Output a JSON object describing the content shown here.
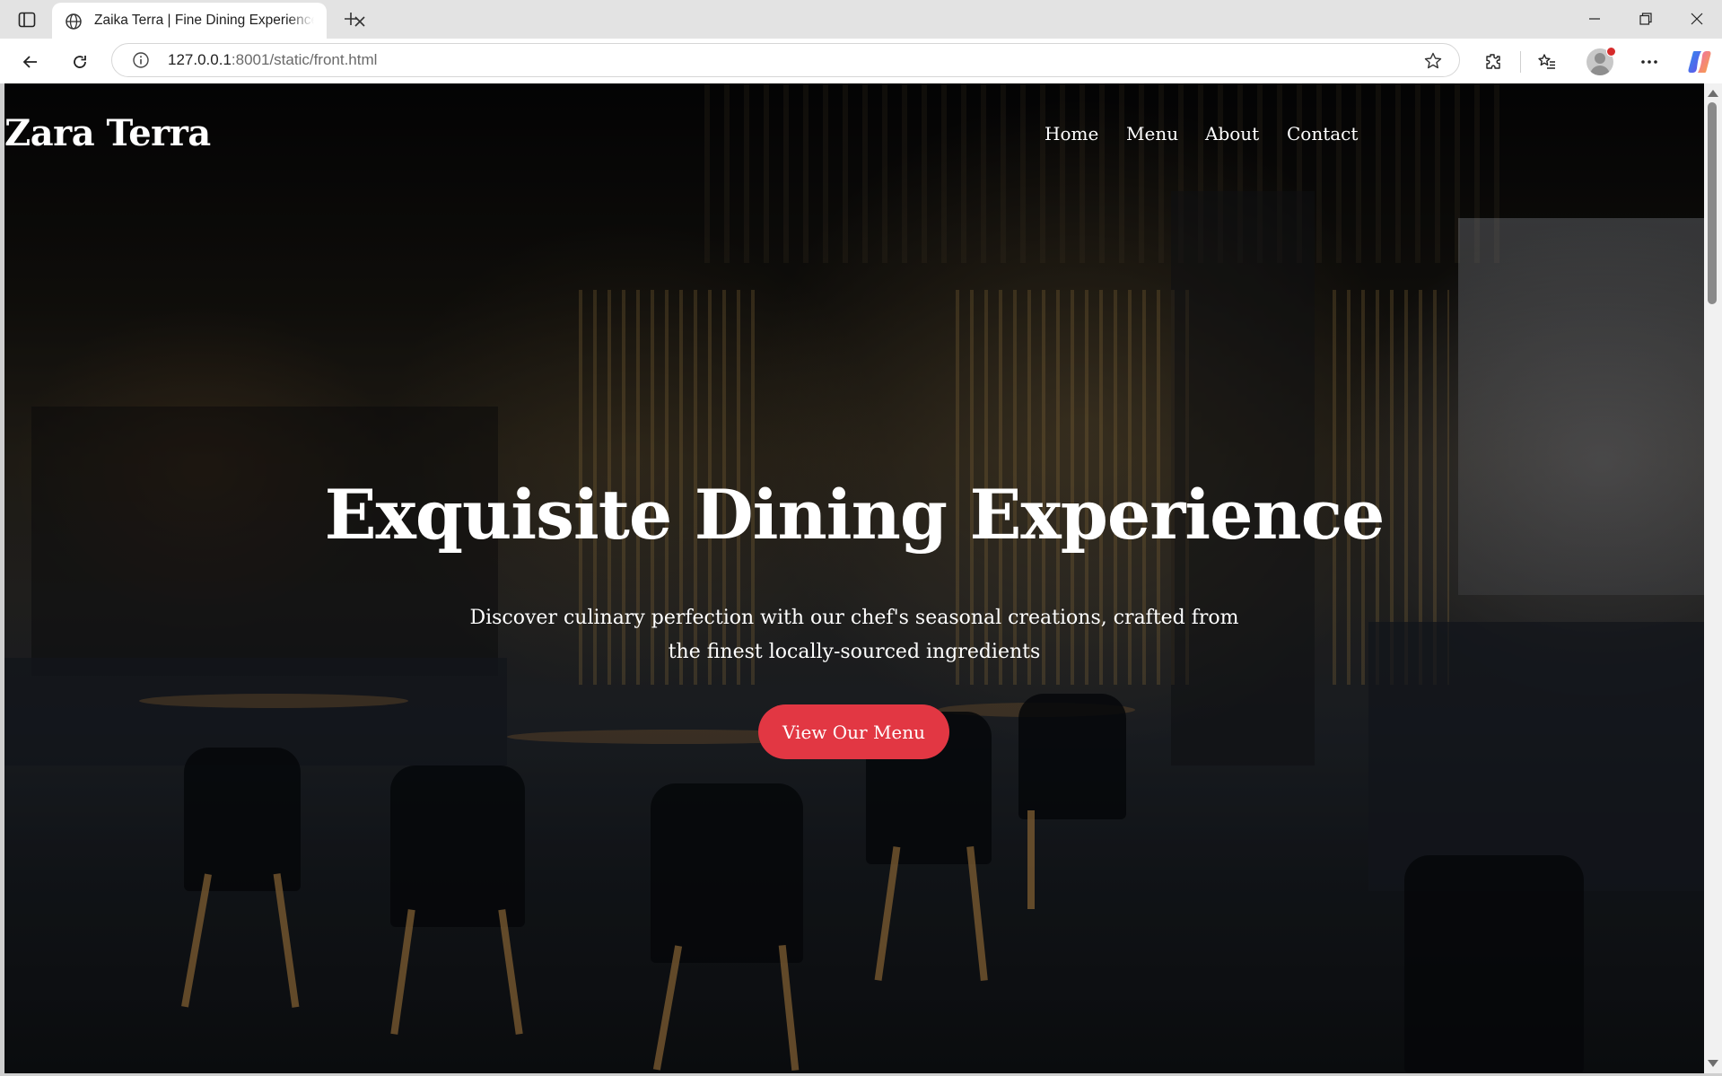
{
  "browser": {
    "tab": {
      "title": "Zaika Terra | Fine Dining Experience"
    },
    "url": {
      "host": "127.0.0.1",
      "rest": ":8001/static/front.html"
    }
  },
  "page": {
    "brand": "Zara Terra",
    "nav": [
      "Home",
      "Menu",
      "About",
      "Contact"
    ],
    "hero": {
      "title": "Exquisite Dining Experience",
      "subtitle": "Discover culinary perfection with our chef's seasonal creations, crafted from the finest locally-sourced ingredients",
      "cta": "View Our Menu"
    }
  },
  "colors": {
    "accent": "#e23743",
    "text": "#ffffff"
  }
}
